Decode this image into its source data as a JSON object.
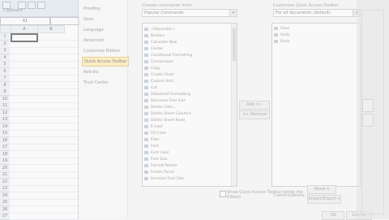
{
  "excel": {
    "clipboard_label": "Clipboard",
    "name_box": "A1",
    "column_headers": [
      "A",
      "B"
    ],
    "row_numbers": [
      "1",
      "2",
      "3",
      "4",
      "5",
      "6",
      "7",
      "8",
      "9",
      "10",
      "11",
      "12",
      "13",
      "14",
      "15",
      "16",
      "17",
      "18",
      "19",
      "20",
      "21",
      "22",
      "23",
      "24",
      "25",
      "26",
      "27"
    ]
  },
  "dialog": {
    "nav": [
      "Proofing",
      "Save",
      "Language",
      "Advanced",
      "Customize Ribbon",
      "Quick Access Toolbar",
      "Add-Ins",
      "Trust Center"
    ],
    "nav_selected_index": 5,
    "choose_commands_label": "Choose commands from:",
    "choose_commands_value": "Popular Commands",
    "customize_qat_label": "Customize Quick Access Toolbar:",
    "customize_qat_value": "For all documents (default)",
    "left_list": [
      "<Separator>",
      "Borders",
      "Calculate Now",
      "Center",
      "Conditional Formatting",
      "Connections",
      "Copy",
      "Create Chart",
      "Custom Sort...",
      "Cut",
      "Datasheet Formatting",
      "Decrease Font Size",
      "Delete Cells...",
      "Delete Sheet Columns",
      "Delete Sheet Rows",
      "E-mail",
      "Fill Color",
      "Filter",
      "Font",
      "Font Color",
      "Font Size",
      "Format Painter",
      "Freeze Panes",
      "Increase Font Size"
    ],
    "right_list": [
      "Save",
      "Undo",
      "Redo"
    ],
    "add_button": "Add >>",
    "remove_button": "<< Remove",
    "show_below_label": "Show Quick Access Toolbar below the Ribbon",
    "customizations_label": "Customizations:",
    "reset_button": "Reset ▾",
    "import_export_button": "Import/Export ▾",
    "ok_button": "OK",
    "cancel_button": "Cancel"
  }
}
